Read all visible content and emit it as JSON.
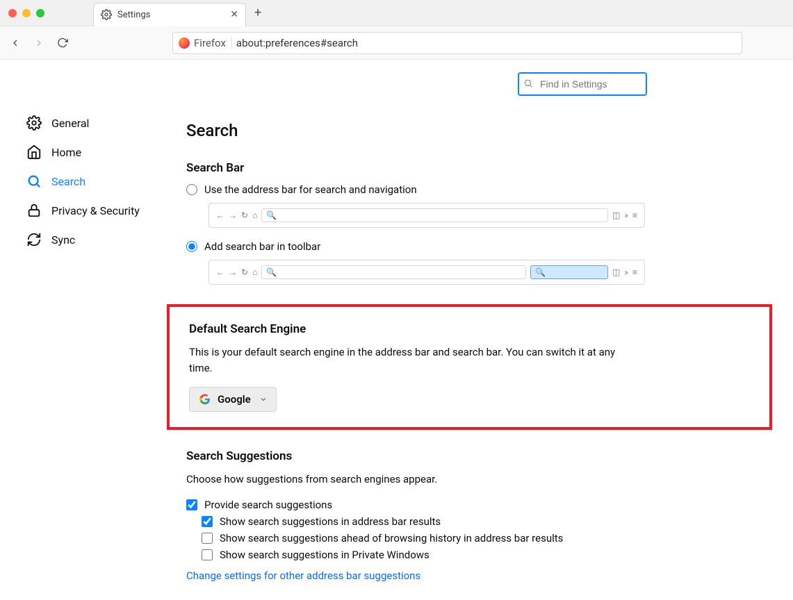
{
  "window": {
    "tab_title": "Settings",
    "url_prefix": "Firefox",
    "url": "about:preferences#search"
  },
  "find": {
    "placeholder": "Find in Settings"
  },
  "sidebar": {
    "items": [
      {
        "label": "General"
      },
      {
        "label": "Home"
      },
      {
        "label": "Search"
      },
      {
        "label": "Privacy & Security"
      },
      {
        "label": "Sync"
      }
    ]
  },
  "page": {
    "title": "Search",
    "search_bar": {
      "heading": "Search Bar",
      "opt1": "Use the address bar for search and navigation",
      "opt2": "Add search bar in toolbar"
    },
    "default_engine": {
      "heading": "Default Search Engine",
      "desc": "This is your default search engine in the address bar and search bar. You can switch it at any time.",
      "selected": "Google"
    },
    "suggestions": {
      "heading": "Search Suggestions",
      "desc": "Choose how suggestions from search engines appear.",
      "c1": "Provide search suggestions",
      "c2": "Show search suggestions in address bar results",
      "c3": "Show search suggestions ahead of browsing history in address bar results",
      "c4": "Show search suggestions in Private Windows",
      "link": "Change settings for other address bar suggestions"
    }
  }
}
